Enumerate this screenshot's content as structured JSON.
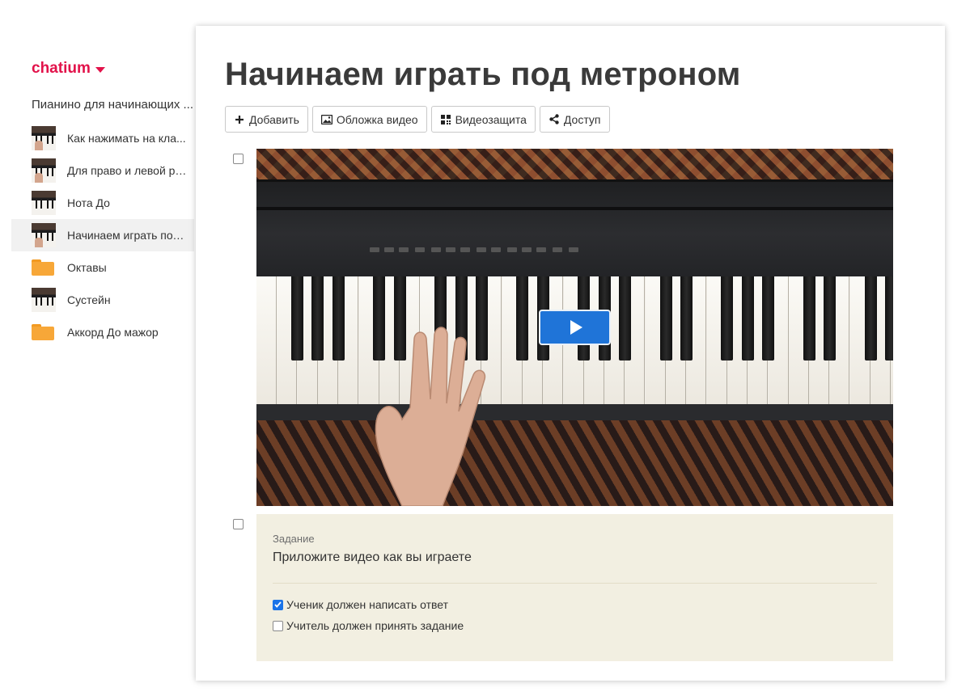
{
  "sidebar": {
    "brand": "chatium",
    "course_title": "Пианино для начинающих ...",
    "items": [
      {
        "label": "Как нажимать на кла...",
        "type": "video",
        "active": false
      },
      {
        "label": "Для право и левой ру...",
        "type": "video",
        "active": false
      },
      {
        "label": "Нота До",
        "type": "video",
        "active": false
      },
      {
        "label": "Начинаем играть под...",
        "type": "video",
        "active": true
      },
      {
        "label": "Октавы",
        "type": "folder",
        "active": false
      },
      {
        "label": "Сустейн",
        "type": "video",
        "active": false
      },
      {
        "label": "Аккорд До мажор",
        "type": "folder",
        "active": false
      }
    ]
  },
  "main": {
    "title": "Начинаем играть под метроном",
    "toolbar": {
      "add_label": "Добавить",
      "cover_label": "Обложка видео",
      "protect_label": "Видеозащита",
      "access_label": "Доступ"
    },
    "task": {
      "label": "Задание",
      "text": "Приложите видео как вы играете",
      "option_answer": "Ученик должен написать ответ",
      "option_answer_checked": true,
      "option_accept": "Учитель должен принять задание",
      "option_accept_checked": false
    }
  },
  "colors": {
    "brand": "#e2124a",
    "play_button": "#1f74d8",
    "task_background": "#f2efe1",
    "folder": "#f7a738",
    "checkbox_checked": "#1a73e8"
  },
  "icons": {
    "brand_caret": "caret-down-icon",
    "add": "plus-icon",
    "cover": "image-icon",
    "protect": "qr-grid-icon",
    "access": "share-icon",
    "play": "play-icon"
  }
}
